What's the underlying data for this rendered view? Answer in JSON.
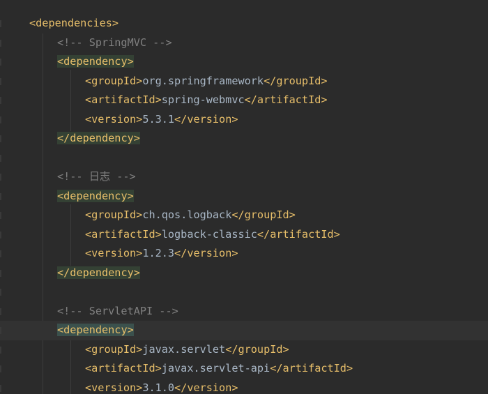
{
  "editor": {
    "lines": [
      {
        "kind": "open",
        "indent": 0,
        "tag": "dependencies"
      },
      {
        "kind": "comment",
        "indent": 1,
        "text": "<!-- SpringMVC -->"
      },
      {
        "kind": "open",
        "indent": 1,
        "tag": "dependency",
        "highlight": "match"
      },
      {
        "kind": "element",
        "indent": 2,
        "tag": "groupId",
        "value": "org.springframework"
      },
      {
        "kind": "element",
        "indent": 2,
        "tag": "artifactId",
        "value": "spring-webmvc"
      },
      {
        "kind": "element",
        "indent": 2,
        "tag": "version",
        "value": "5.3.1"
      },
      {
        "kind": "close",
        "indent": 1,
        "tag": "dependency",
        "highlight": "match"
      },
      {
        "kind": "blank"
      },
      {
        "kind": "comment",
        "indent": 1,
        "text": "<!-- 日志 -->"
      },
      {
        "kind": "open",
        "indent": 1,
        "tag": "dependency",
        "highlight": "match"
      },
      {
        "kind": "element",
        "indent": 2,
        "tag": "groupId",
        "value": "ch.qos.logback"
      },
      {
        "kind": "element",
        "indent": 2,
        "tag": "artifactId",
        "value": "logback-classic"
      },
      {
        "kind": "element",
        "indent": 2,
        "tag": "version",
        "value": "1.2.3"
      },
      {
        "kind": "close",
        "indent": 1,
        "tag": "dependency",
        "highlight": "match"
      },
      {
        "kind": "blank"
      },
      {
        "kind": "comment",
        "indent": 1,
        "text": "<!-- ServletAPI -->"
      },
      {
        "kind": "open",
        "indent": 1,
        "tag": "dependency",
        "highlight": "caret",
        "current": true
      },
      {
        "kind": "element",
        "indent": 2,
        "tag": "groupId",
        "value": "javax.servlet"
      },
      {
        "kind": "element",
        "indent": 2,
        "tag": "artifactId",
        "value": "javax.servlet-api"
      },
      {
        "kind": "element",
        "indent": 2,
        "tag": "version",
        "value": "3.1.0"
      }
    ]
  },
  "colors": {
    "background": "#2b2b2b",
    "tag": "#e8bf6a",
    "text": "#a9b7c6",
    "comment": "#808080",
    "tag_match_highlight": "#344134",
    "caret_tag_highlight": "#3b514d",
    "current_line": "#323232"
  }
}
